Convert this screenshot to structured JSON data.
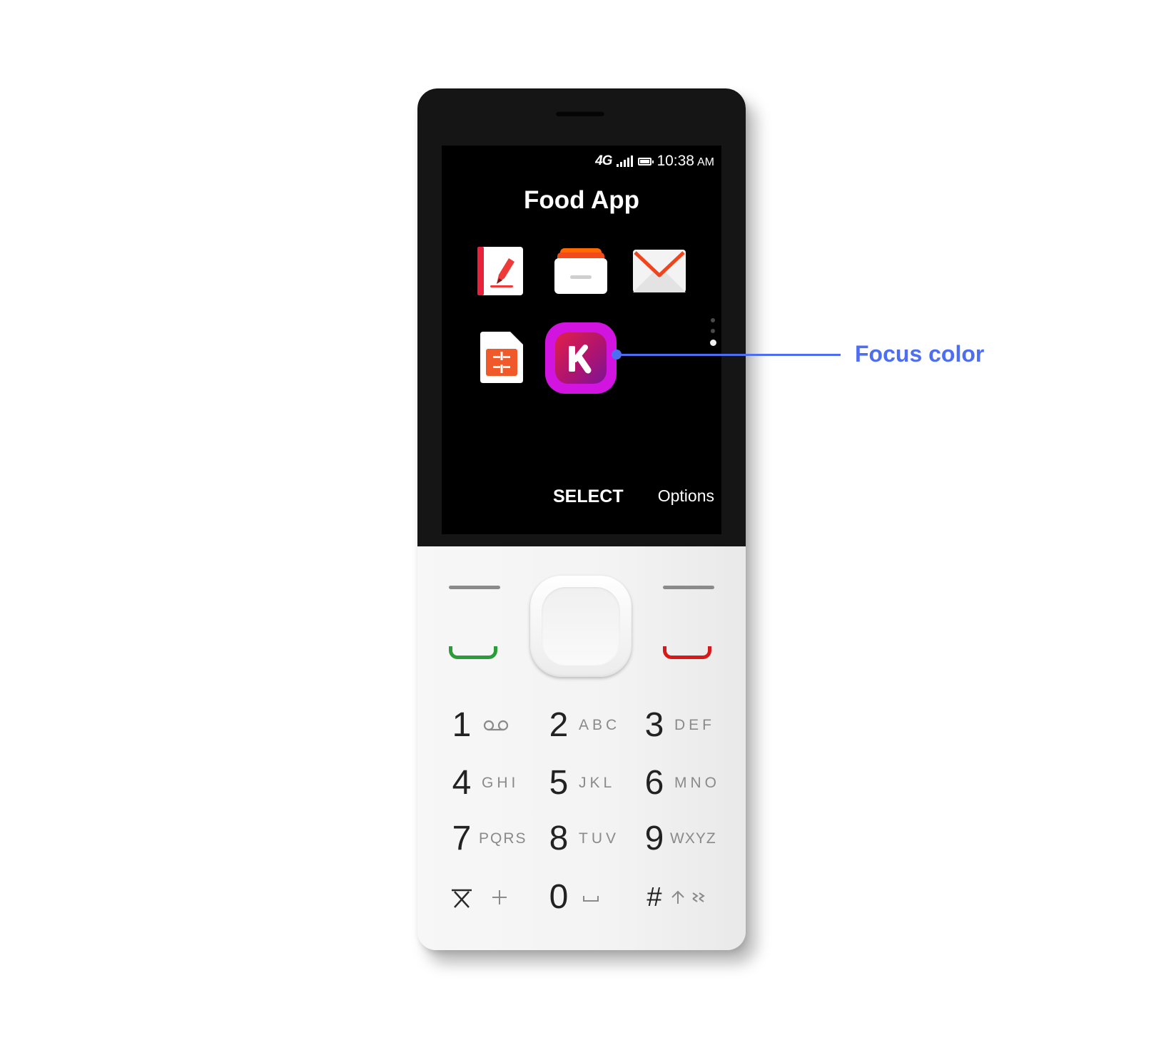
{
  "status_bar": {
    "network": "4G",
    "time": "10:38",
    "ampm": "AM"
  },
  "screen": {
    "title": "Food App"
  },
  "apps": [
    {
      "name": "notes-app",
      "icon": "notebook-pencil-icon"
    },
    {
      "name": "store-app",
      "icon": "store-drawer-icon"
    },
    {
      "name": "email-app",
      "icon": "envelope-icon"
    },
    {
      "name": "sim-app",
      "icon": "sim-card-icon"
    },
    {
      "name": "kaios-app",
      "icon": "k-logo-icon",
      "focused": true
    }
  ],
  "softkeys": {
    "center": "SELECT",
    "right": "Options"
  },
  "keypad": [
    {
      "digit": "1",
      "letters": ""
    },
    {
      "digit": "2",
      "letters": "ABC"
    },
    {
      "digit": "3",
      "letters": "DEF"
    },
    {
      "digit": "4",
      "letters": "GHI"
    },
    {
      "digit": "5",
      "letters": "JKL"
    },
    {
      "digit": "6",
      "letters": "MNO"
    },
    {
      "digit": "7",
      "letters": "PQRS"
    },
    {
      "digit": "8",
      "letters": "TUV"
    },
    {
      "digit": "9",
      "letters": "WXYZ"
    },
    {
      "digit": "0",
      "letters": ""
    },
    {
      "digit": "#",
      "letters": ""
    }
  ],
  "annotation": {
    "label": "Focus color",
    "color": "#4e6ef2"
  },
  "colors": {
    "focus": "#d114e0",
    "call": "#2a9d3a",
    "end": "#d61a1a"
  }
}
